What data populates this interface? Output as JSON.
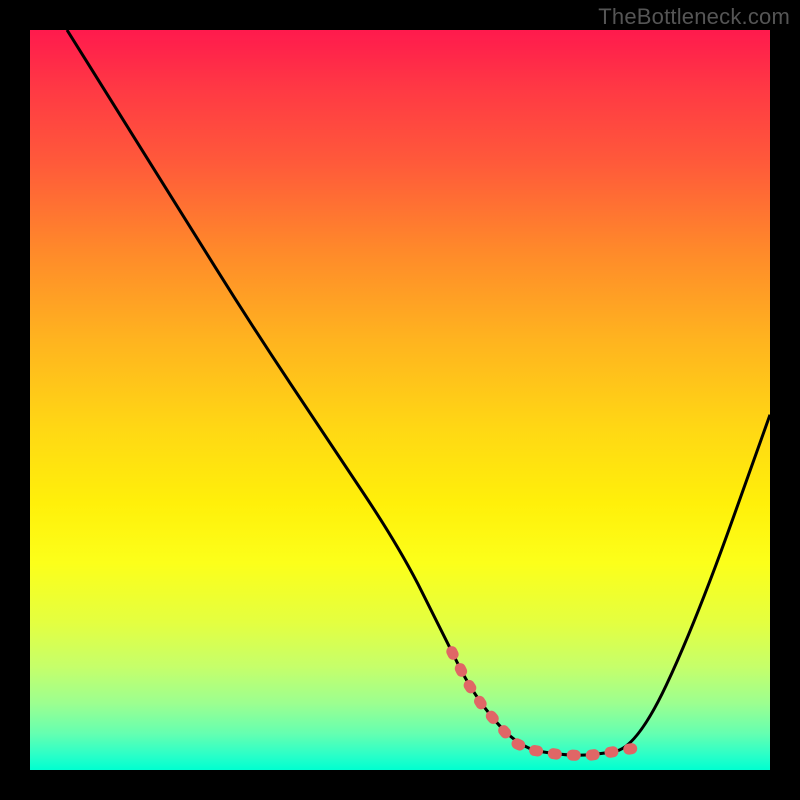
{
  "watermark": "TheBottleneck.com",
  "chart_data": {
    "type": "line",
    "title": "",
    "xlabel": "",
    "ylabel": "",
    "xlim": [
      0,
      100
    ],
    "ylim": [
      0,
      100
    ],
    "series": [
      {
        "name": "curve",
        "x": [
          5,
          10,
          20,
          30,
          40,
          50,
          56,
          60,
          66,
          72,
          76,
          82,
          90,
          100
        ],
        "values": [
          100,
          92,
          76,
          60,
          45,
          30,
          18,
          10,
          3,
          2,
          2,
          3,
          20,
          48
        ]
      }
    ],
    "highlight_segment": {
      "x_start": 57,
      "x_end": 82
    },
    "gradient_stops": [
      {
        "pos": 0,
        "color": "#ff1a4d"
      },
      {
        "pos": 8,
        "color": "#ff3944"
      },
      {
        "pos": 18,
        "color": "#ff5a3a"
      },
      {
        "pos": 30,
        "color": "#ff8a2a"
      },
      {
        "pos": 42,
        "color": "#ffb41f"
      },
      {
        "pos": 54,
        "color": "#ffd814"
      },
      {
        "pos": 64,
        "color": "#fff00a"
      },
      {
        "pos": 72,
        "color": "#fcff1a"
      },
      {
        "pos": 80,
        "color": "#e4ff40"
      },
      {
        "pos": 86,
        "color": "#c6ff6a"
      },
      {
        "pos": 91,
        "color": "#9cff90"
      },
      {
        "pos": 95,
        "color": "#66ffb0"
      },
      {
        "pos": 98,
        "color": "#2affc8"
      },
      {
        "pos": 100,
        "color": "#00ffd0"
      }
    ],
    "highlight_color": "#e06666"
  }
}
